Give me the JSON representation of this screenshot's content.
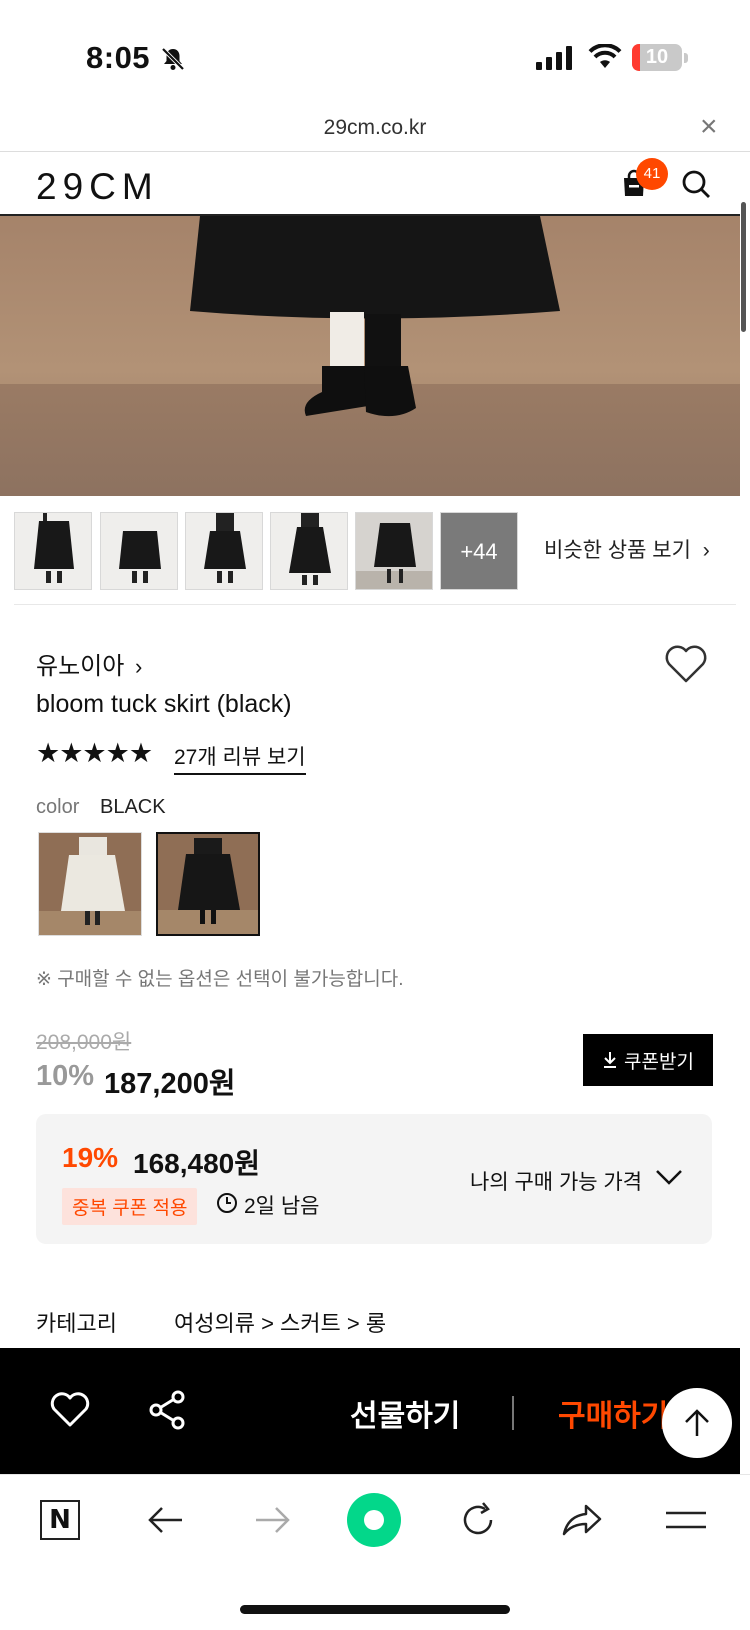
{
  "status_bar": {
    "time": "8:05",
    "battery": "10"
  },
  "browser": {
    "url": "29cm.co.kr",
    "close_glyph": "×"
  },
  "header": {
    "logo": "29CM",
    "cart_count": "41"
  },
  "gallery": {
    "more_count": "+44",
    "similar_label": "비슷한 상품 보기"
  },
  "product": {
    "brand": "유노이아",
    "title": "bloom tuck skirt (black)",
    "stars": "★★★★★",
    "review_link": "27개 리뷰 보기",
    "color_label": "color",
    "color_value": "BLACK",
    "options_note": "※ 구매할 수 없는 옵션은 선택이 불가능합니다."
  },
  "price": {
    "original": "208,000원",
    "discount_pct": "10%",
    "sale": "187,200원",
    "coupon_button": "쿠폰받기"
  },
  "best_price": {
    "pct": "19%",
    "price": "168,480원",
    "badge": "중복 쿠폰 적용",
    "days_left": "2일 남음",
    "my_price_label": "나의 구매 가능 가격"
  },
  "category": {
    "label": "카테고리",
    "path": "여성의류 > 스커트 > 롱"
  },
  "action_bar": {
    "gift": "선물하기",
    "buy": "구매하기"
  },
  "browser_nav": {
    "naver_label": "N"
  },
  "colors": {
    "accent": "#ff4800",
    "black": "#000000"
  }
}
